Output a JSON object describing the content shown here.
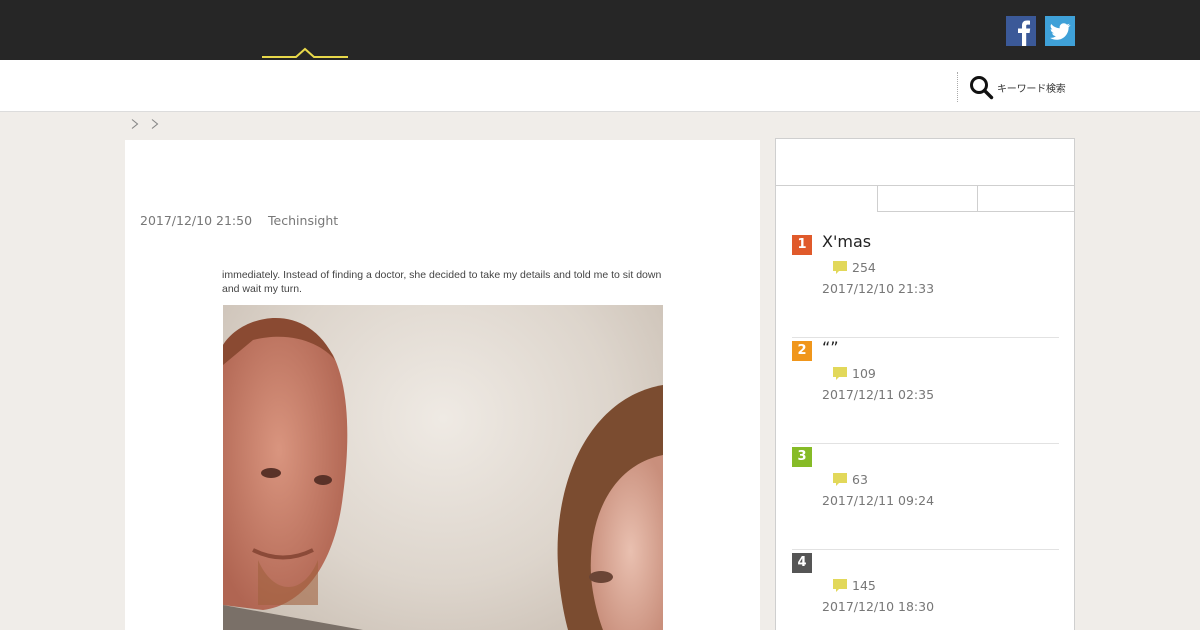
{
  "header": {
    "social": [
      {
        "name": "facebook",
        "glyph": "f",
        "color": "#3b5998"
      },
      {
        "name": "twitter",
        "color": "#3fa1d8"
      }
    ],
    "accent_color": "#e8d84a"
  },
  "nav": {
    "search_label": "キーワード検索"
  },
  "article": {
    "date": "2017/12/10 21:50",
    "author": "Techinsight",
    "photo_caption": "immediately. Instead of finding a doctor, she decided to take my details and told me to sit down and wait my turn."
  },
  "ranking": {
    "items": [
      {
        "rank": "1",
        "title": "X'mas",
        "comments": "254",
        "date": "2017/12/10 21:33",
        "color": "#e05a2b"
      },
      {
        "rank": "2",
        "title": "“”",
        "comments": "109",
        "date": "2017/12/11 02:35",
        "color": "#f0961b"
      },
      {
        "rank": "3",
        "title": "",
        "comments": "63",
        "date": "2017/12/11 09:24",
        "color": "#86bb27"
      },
      {
        "rank": "4",
        "title": "",
        "comments": "145",
        "date": "2017/12/10 18:30",
        "color": "#555555"
      }
    ],
    "comment_icon_color": "#e2d85a"
  }
}
